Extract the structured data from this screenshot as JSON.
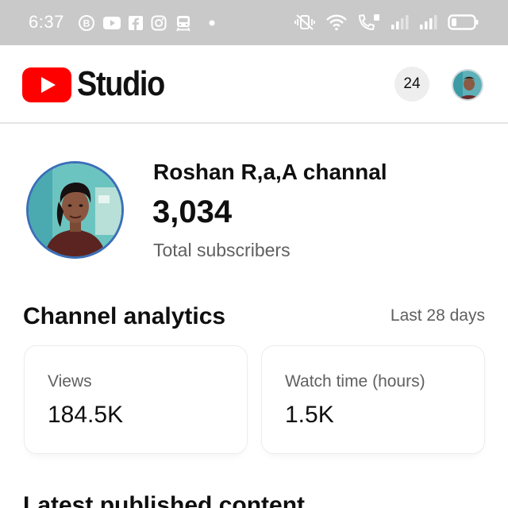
{
  "status_bar": {
    "time": "6:37",
    "left_icons": [
      "b-circle-icon",
      "youtube-icon",
      "facebook-icon",
      "instagram-icon",
      "train-icon",
      "dot-icon"
    ],
    "right_icons": [
      "vibrate-off-icon",
      "wifi-icon",
      "volte-call-icon",
      "signal-icon",
      "signal-icon",
      "battery-icon"
    ]
  },
  "header": {
    "logo_text": "Studio",
    "notification_count": "24",
    "brand_color": "#ff0000"
  },
  "channel": {
    "name": "Roshan R,a,A channal",
    "subscribers": "3,034",
    "subscribers_label": "Total subscribers"
  },
  "analytics": {
    "title": "Channel analytics",
    "range": "Last 28 days",
    "cards": [
      {
        "label": "Views",
        "value": "184.5K"
      },
      {
        "label": "Watch time (hours)",
        "value": "1.5K"
      }
    ]
  },
  "latest": {
    "title": "Latest published content"
  }
}
